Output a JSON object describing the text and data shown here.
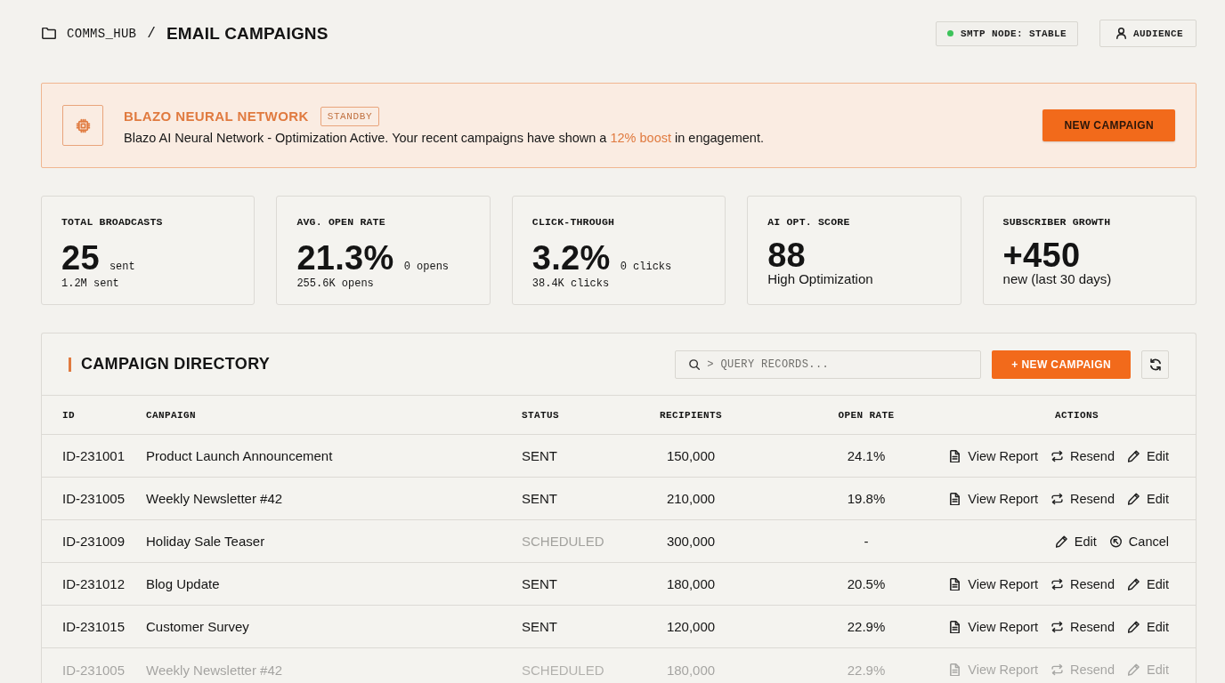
{
  "breadcrumb": {
    "parent": "COMMS_HUB",
    "separator": "/",
    "title": "EMAIL CAMPAIGNS"
  },
  "header_actions": {
    "status_badge": {
      "label": "SMTP NODE: STABLE"
    },
    "audience_button": {
      "label": "AUDIENCE"
    }
  },
  "banner": {
    "title": "BLAZO NEURAL NETWORK",
    "badge": "STANDBY",
    "message": "Blazo AI Neural Network - Optimization Active. Your recent campaigns have shown a **12% boost** in engagement.",
    "button": "NEW CAMPAIGN"
  },
  "stats": [
    {
      "kind": "metric",
      "label": "TOTAL BROADCASTS",
      "value": "25",
      "unit": "sent",
      "detail": "1.2M sent"
    },
    {
      "kind": "metric",
      "label": "AVG. OPEN RATE",
      "value": "21.3%",
      "unit": "0 opens",
      "detail": "255.6K opens"
    },
    {
      "kind": "metric",
      "label": "CLICK-THROUGH",
      "value": "3.2%",
      "unit": "0 clicks",
      "detail": "38.4K clicks"
    },
    {
      "kind": "summary",
      "label": "AI OPT. SCORE",
      "value": "88",
      "detail": "High Optimization"
    },
    {
      "kind": "summary",
      "label": "SUBSCRIBER GROWTH",
      "value": "+450",
      "detail": "new (last 30 days)"
    }
  ],
  "directory": {
    "title": "CAMPAIGN DIRECTORY",
    "search": {
      "placeholder": "> QUERY RECORDS..."
    },
    "new_button": "+ NEW CAMPAIGN",
    "table": {
      "columns": [
        "ID",
        "CANPAIGN",
        "STATUS",
        "RECIPIENTS",
        "OPEN RATE",
        "ACTIONS"
      ],
      "rows": [
        {
          "kind": "sent",
          "id": "ID-231001",
          "campaign": "Product Launch Announcement",
          "status": "SENT",
          "recipients": "150,000",
          "open_rate": "24.1%",
          "actions": [
            {
              "kind": "report",
              "label": "View Report"
            },
            {
              "kind": "resend",
              "label": "Resend"
            },
            {
              "kind": "edit",
              "label": "Edit"
            }
          ]
        },
        {
          "kind": "sent",
          "id": "ID-231005",
          "campaign": "Weekly Newsletter #42",
          "status": "SENT",
          "recipients": "210,000",
          "open_rate": "19.8%",
          "actions": [
            {
              "kind": "report",
              "label": "View Report"
            },
            {
              "kind": "resend",
              "label": "Resend"
            },
            {
              "kind": "edit",
              "label": "Edit"
            }
          ]
        },
        {
          "kind": "scheduled",
          "id": "ID-231009",
          "campaign": "Holiday Sale Teaser",
          "status": "SCHEDULED",
          "recipients": "300,000",
          "open_rate": "-",
          "actions": [
            {
              "kind": "edit",
              "label": "Edit"
            },
            {
              "kind": "cancel",
              "label": "Cancel"
            }
          ]
        },
        {
          "kind": "sent",
          "id": "ID-231012",
          "campaign": "Blog Update",
          "status": "SENT",
          "recipients": "180,000",
          "open_rate": "20.5%",
          "actions": [
            {
              "kind": "report",
              "label": "View Report"
            },
            {
              "kind": "resend",
              "label": "Resend"
            },
            {
              "kind": "edit",
              "label": "Edit"
            }
          ]
        },
        {
          "kind": "sent",
          "id": "ID-231015",
          "campaign": "Customer Survey",
          "status": "SENT",
          "recipients": "120,000",
          "open_rate": "22.9%",
          "actions": [
            {
              "kind": "report",
              "label": "View Report"
            },
            {
              "kind": "resend",
              "label": "Resend"
            },
            {
              "kind": "edit",
              "label": "Edit"
            }
          ]
        },
        {
          "kind": "scheduled",
          "id": "ID-231005",
          "campaign": "Weekly Newsletter #42",
          "status": "SCHEDULED",
          "recipients": "180,000",
          "open_rate": "22.9%",
          "actions": [
            {
              "kind": "report",
              "label": "View Report"
            },
            {
              "kind": "resend",
              "label": "Resend"
            },
            {
              "kind": "edit",
              "label": "Edit"
            }
          ]
        }
      ]
    }
  }
}
